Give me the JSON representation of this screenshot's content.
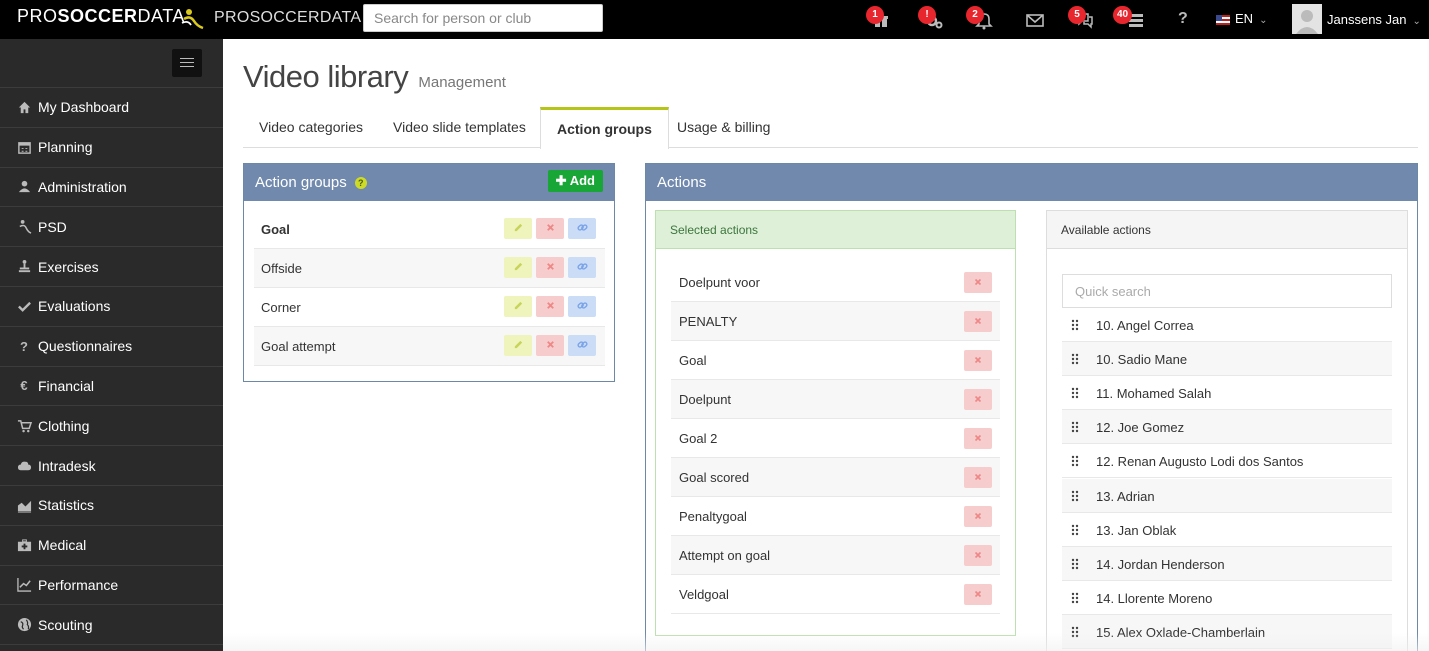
{
  "topbar": {
    "brand_main": "PRO",
    "brand_accent": "SOCCER",
    "brand_tail": "DATA",
    "logo_text": "PROSOCCERDATA",
    "search_placeholder": "Search for person or club",
    "notifications": [
      {
        "icon": "gift-icon",
        "badge": "1"
      },
      {
        "icon": "cogs-icon",
        "badge": "!"
      },
      {
        "icon": "bell-icon",
        "badge": "2"
      },
      {
        "icon": "envelope-icon",
        "badge": ""
      },
      {
        "icon": "comments-icon",
        "badge": "5"
      },
      {
        "icon": "tasks-icon",
        "badge": "40"
      },
      {
        "icon": "question-icon",
        "badge": ""
      }
    ],
    "language": "EN",
    "user_name": "Janssens Jan"
  },
  "sidebar": {
    "items": [
      {
        "label": "My Dashboard",
        "icon": "home-icon"
      },
      {
        "label": "Planning",
        "icon": "calendar-icon"
      },
      {
        "label": "Administration",
        "icon": "user-icon"
      },
      {
        "label": "PSD",
        "icon": "psd-logo-icon"
      },
      {
        "label": "Exercises",
        "icon": "exercise-icon"
      },
      {
        "label": "Evaluations",
        "icon": "check-icon"
      },
      {
        "label": "Questionnaires",
        "icon": "question-icon"
      },
      {
        "label": "Financial",
        "icon": "euro-icon"
      },
      {
        "label": "Clothing",
        "icon": "cart-icon"
      },
      {
        "label": "Intradesk",
        "icon": "cloud-icon"
      },
      {
        "label": "Statistics",
        "icon": "area-chart-icon"
      },
      {
        "label": "Medical",
        "icon": "medkit-icon"
      },
      {
        "label": "Performance",
        "icon": "line-chart-icon"
      },
      {
        "label": "Scouting",
        "icon": "globe-icon"
      }
    ]
  },
  "page": {
    "title": "Video library",
    "subtitle": "Management"
  },
  "tabs": [
    {
      "label": "Video categories",
      "active": false
    },
    {
      "label": "Video slide templates",
      "active": false
    },
    {
      "label": "Action groups",
      "active": true
    },
    {
      "label": "Usage & billing",
      "active": false
    }
  ],
  "action_groups_panel": {
    "title": "Action groups",
    "add_label": "Add",
    "groups": [
      {
        "label": "Goal",
        "selected": true
      },
      {
        "label": "Offside",
        "selected": false
      },
      {
        "label": "Corner",
        "selected": false
      },
      {
        "label": "Goal attempt",
        "selected": false
      }
    ]
  },
  "actions_panel": {
    "title": "Actions",
    "selected_title": "Selected actions",
    "selected": [
      "Doelpunt voor",
      "PENALTY",
      "Goal",
      "Doelpunt",
      "Goal 2",
      "Goal scored",
      "Penaltygoal",
      "Attempt on goal",
      "Veldgoal"
    ],
    "available_title": "Available actions",
    "quick_search_placeholder": "Quick search",
    "available": [
      "10. Angel Correa",
      "10. Sadio Mane",
      "11. Mohamed Salah",
      "12. Joe Gomez",
      "12. Renan Augusto Lodi dos Santos",
      "13. Adrian",
      "13. Jan Oblak",
      "14. Jordan Henderson",
      "14. Llorente Moreno",
      "15. Alex Oxlade-Chamberlain"
    ]
  },
  "colors": {
    "panel_header": "#7189ad",
    "add_button": "#18a636",
    "tab_active_border": "#b5c418",
    "badge": "#e8262e"
  }
}
